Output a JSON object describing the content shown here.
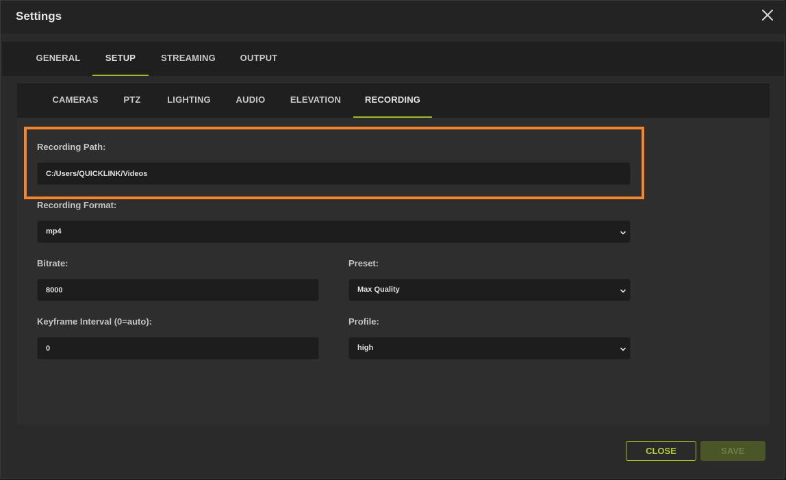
{
  "window": {
    "title": "Settings"
  },
  "top_tabs": [
    {
      "label": "GENERAL",
      "active": false
    },
    {
      "label": "SETUP",
      "active": true
    },
    {
      "label": "STREAMING",
      "active": false
    },
    {
      "label": "OUTPUT",
      "active": false
    }
  ],
  "sub_tabs": [
    {
      "label": "CAMERAS",
      "active": false
    },
    {
      "label": "PTZ",
      "active": false
    },
    {
      "label": "LIGHTING",
      "active": false
    },
    {
      "label": "AUDIO",
      "active": false
    },
    {
      "label": "ELEVATION",
      "active": false
    },
    {
      "label": "RECORDING",
      "active": true
    }
  ],
  "form": {
    "recording_path": {
      "label": "Recording Path:",
      "value": "C:/Users/QUICKLINK/Videos"
    },
    "recording_format": {
      "label": "Recording Format:",
      "value": "mp4"
    },
    "bitrate": {
      "label": "Bitrate:",
      "value": "8000"
    },
    "preset": {
      "label": "Preset:",
      "value": "Max Quality"
    },
    "keyframe_interval": {
      "label": "Keyframe Interval (0=auto):",
      "value": "0"
    },
    "profile": {
      "label": "Profile:",
      "value": "high"
    }
  },
  "footer": {
    "close_label": "CLOSE",
    "save_label": "SAVE"
  },
  "icons": {
    "close": "close-icon",
    "dropdown": "chevron-down-icon"
  },
  "colors": {
    "accent": "#9fb82c",
    "highlight": "#f5852a"
  }
}
